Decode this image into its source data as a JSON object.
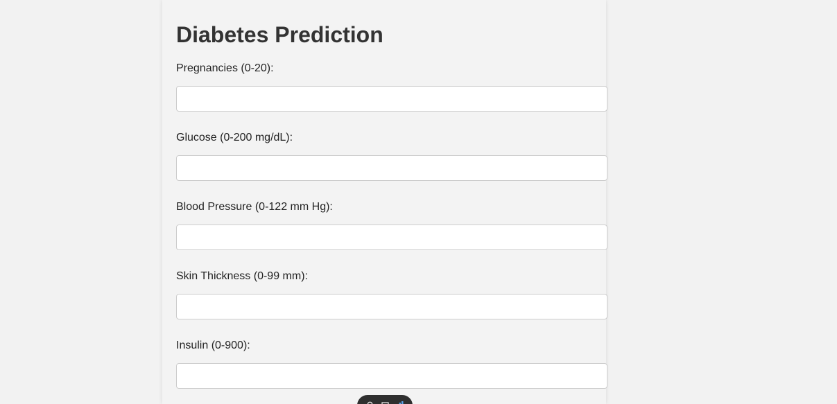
{
  "form": {
    "title": "Diabetes Prediction",
    "fields": [
      {
        "label": "Pregnancies (0-20):",
        "value": "",
        "placeholder": ""
      },
      {
        "label": "Glucose (0-200 mg/dL):",
        "value": "",
        "placeholder": ""
      },
      {
        "label": "Blood Pressure (0-122 mm Hg):",
        "value": "",
        "placeholder": ""
      },
      {
        "label": "Skin Thickness (0-99 mm):",
        "value": "",
        "placeholder": ""
      },
      {
        "label": "Insulin (0-900):",
        "value": "",
        "placeholder": ""
      }
    ]
  },
  "toolbar": {
    "icons": [
      "search-icon",
      "chat-icon",
      "chart-icon"
    ]
  },
  "colors": {
    "page_background": "#f2f2f2",
    "card_background": "#f3f3f3",
    "title_text": "#333333",
    "input_border": "#cccccc",
    "toolbar_background": "#2f2f2f",
    "toolbar_accent": "#5aa0e6"
  }
}
